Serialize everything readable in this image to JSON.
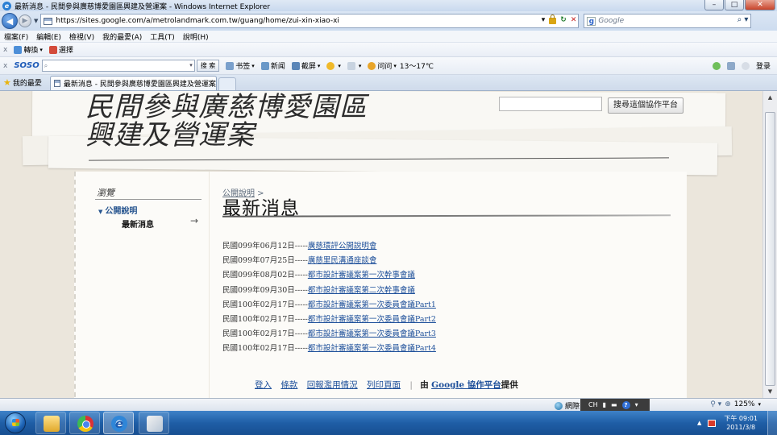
{
  "window": {
    "title": "最新消息 - 民間參與廣慈博愛園區興建及營運案 - Windows Internet Explorer",
    "min": "–",
    "max": "□",
    "close": "✕"
  },
  "address": {
    "url": "https://sites.google.com/a/metrolandmark.com.tw/guang/home/zui-xin-xiao-xi",
    "search_placeholder": "Google"
  },
  "menu": [
    "檔案(F)",
    "編輯(E)",
    "檢視(V)",
    "我的最愛(A)",
    "工具(T)",
    "說明(H)"
  ],
  "toolbar1": {
    "convert": "轉換",
    "select": "選擇"
  },
  "toolbar2": {
    "brand": "SOSO",
    "search_button": "搜 索",
    "items": [
      "书签",
      "新闻",
      "截屏"
    ],
    "weather_label": "问问",
    "weather_temp": "13～17℃",
    "login": "登录"
  },
  "tabs": {
    "favorites": "我的最愛",
    "active_tab": "最新消息 - 民間參與廣慈博愛園區興建及營運案"
  },
  "site": {
    "title_line1": "民間參與廣慈博愛園區",
    "title_line2": "興建及營運案",
    "search_button": "搜尋這個協作平台"
  },
  "sidebar": {
    "title": "瀏覽",
    "section": "公開說明",
    "current": "最新消息",
    "arrow": "→"
  },
  "content": {
    "breadcrumb": "公開說明",
    "breadcrumb_sep": " >",
    "title": "最新消息",
    "items": [
      {
        "date": "民國099年06月12日-----",
        "link": "廣慈環評公開說明會"
      },
      {
        "date": "民國099年07月25日-----",
        "link": "廣慈里民溝通座談會"
      },
      {
        "date": "民國099年08月02日-----",
        "link": "都市設計審議案第一次幹事會議"
      },
      {
        "date": "民國099年09月30日-----",
        "link": "都市設計審議案第二次幹事會議"
      },
      {
        "date": "民國100年02月17日-----",
        "link": "都市設計審議案第一次委員會議Part1"
      },
      {
        "date": "民國100年02月17日-----",
        "link": "都市設計審議案第一次委員會議Part2"
      },
      {
        "date": "民國100年02月17日-----",
        "link": "都市設計審議案第一次委員會議Part3"
      },
      {
        "date": "民國100年02月17日-----",
        "link": "都市設計審議案第一次委員會議Part4"
      }
    ]
  },
  "footer": {
    "login": "登入",
    "terms": "條款",
    "report": "回報濫用情況",
    "print": "列印頁面",
    "by": "由",
    "brand": "Google 協作平台",
    "provided": "提供"
  },
  "status": {
    "network": "網際",
    "ime": "CH",
    "zoom": "125%"
  },
  "taskbar": {
    "time": "下午 09:01",
    "date": "2011/3/8"
  }
}
